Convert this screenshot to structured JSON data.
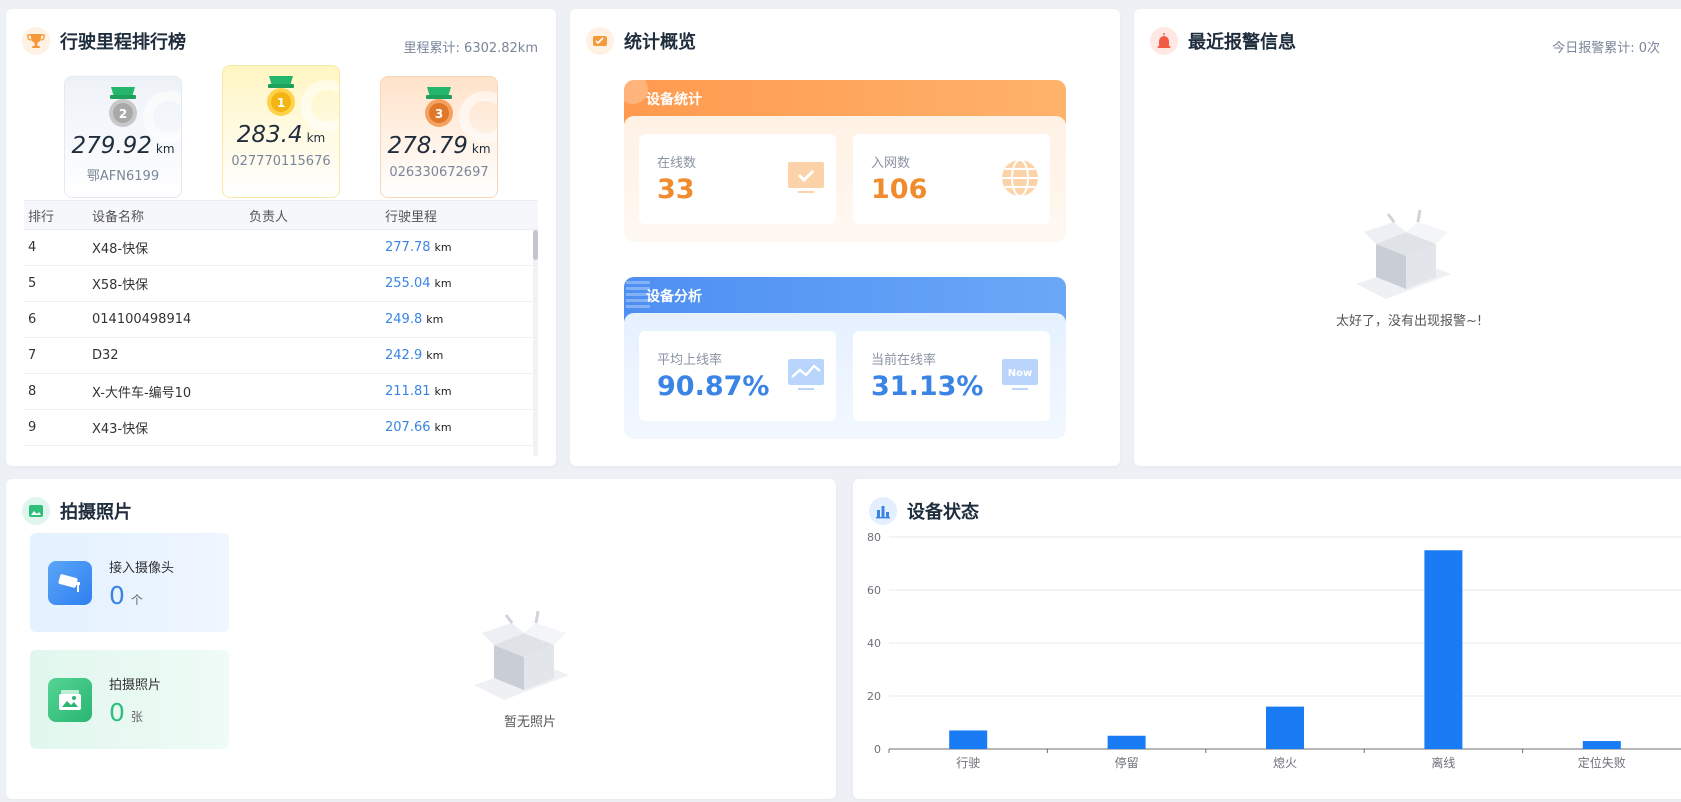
{
  "ranking": {
    "title": "行驶里程排行榜",
    "total_label": "里程累计: 6302.82km",
    "podium": [
      {
        "rank": "2",
        "distance": "279.92",
        "unit": "km",
        "plate": "鄂AFN6199"
      },
      {
        "rank": "1",
        "distance": "283.4",
        "unit": "km",
        "plate": "027770115676"
      },
      {
        "rank": "3",
        "distance": "278.79",
        "unit": "km",
        "plate": "026330672697"
      }
    ],
    "columns": [
      "排行",
      "设备名称",
      "负责人",
      "行驶里程"
    ],
    "rows": [
      {
        "rank": "4",
        "name": "X48-快保",
        "owner": "",
        "mileage": "277.78",
        "unit": "km"
      },
      {
        "rank": "5",
        "name": "X58-快保",
        "owner": "",
        "mileage": "255.04",
        "unit": "km"
      },
      {
        "rank": "6",
        "name": "014100498914",
        "owner": "",
        "mileage": "249.8",
        "unit": "km"
      },
      {
        "rank": "7",
        "name": "D32",
        "owner": "",
        "mileage": "242.9",
        "unit": "km"
      },
      {
        "rank": "8",
        "name": "X-大件车-编号10",
        "owner": "",
        "mileage": "211.81",
        "unit": "km"
      },
      {
        "rank": "9",
        "name": "X43-快保",
        "owner": "",
        "mileage": "207.66",
        "unit": "km"
      }
    ]
  },
  "overview": {
    "title": "统计概览",
    "device_stats": {
      "label": "设备统计",
      "online_label": "在线数",
      "online_value": "33",
      "network_label": "入网数",
      "network_value": "106"
    },
    "device_analysis": {
      "label": "设备分析",
      "avg_online_label": "平均上线率",
      "avg_online_value": "90.87%",
      "current_online_label": "当前在线率",
      "current_online_value": "31.13%",
      "now_badge": "Now"
    }
  },
  "alarms": {
    "title": "最近报警信息",
    "today_label": "今日报警累计: 0次",
    "empty_text": "太好了，没有出现报警~!"
  },
  "photos": {
    "title": "拍摄照片",
    "camera_label": "接入摄像头",
    "camera_value": "0",
    "camera_unit": "个",
    "photo_label": "拍摄照片",
    "photo_value": "0",
    "photo_unit": "张",
    "empty_text": "暂无照片"
  },
  "device_status": {
    "title": "设备状态"
  },
  "chart_data": {
    "type": "bar",
    "categories": [
      "行驶",
      "停留",
      "熄火",
      "离线",
      "定位失败"
    ],
    "values": [
      7,
      5,
      16,
      75,
      3
    ],
    "ylim": [
      0,
      80
    ],
    "yticks": [
      0,
      20,
      40,
      60,
      80
    ],
    "grid": true,
    "color": "#1a7cf5"
  },
  "colors": {
    "accent_blue": "#3a84e6",
    "accent_orange": "#f08c2e",
    "photo_green": "#2ec07a"
  }
}
